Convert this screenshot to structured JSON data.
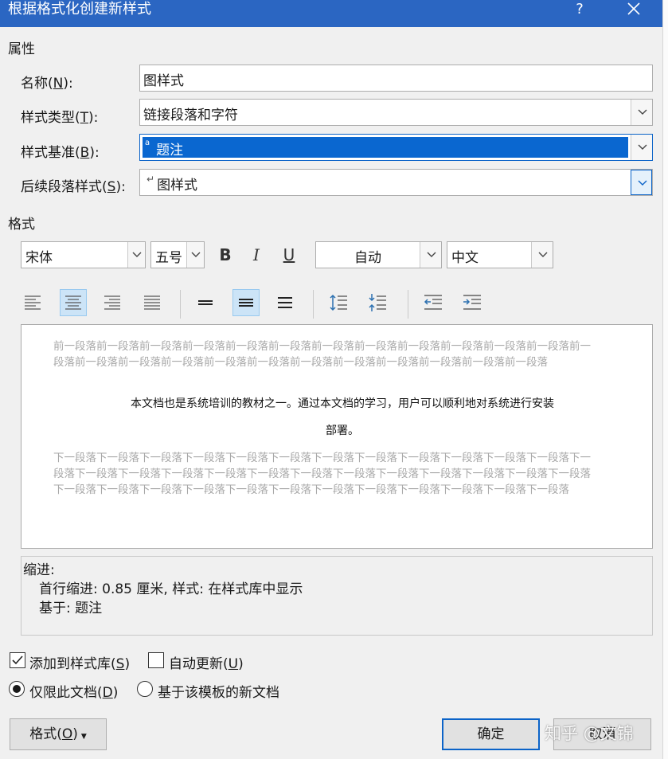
{
  "titlebar": {
    "title": "根据格式化创建新样式",
    "help": "?"
  },
  "properties": {
    "section": "属性",
    "name": {
      "label_pre": "名称(",
      "label_key": "N",
      "label_post": "):",
      "value": "图样式"
    },
    "style_type": {
      "label_pre": "样式类型(",
      "label_key": "T",
      "label_post": "):",
      "value": "链接段落和字符"
    },
    "based_on": {
      "label_pre": "样式基准(",
      "label_key": "B",
      "label_post": "):",
      "value": "题注",
      "glyph": "a"
    },
    "next_style": {
      "label_pre": "后续段落样式(",
      "label_key": "S",
      "label_post": "):",
      "value": "图样式",
      "glyph": "↵"
    }
  },
  "format": {
    "section": "格式",
    "font": "宋体",
    "size": "五号",
    "bold": "B",
    "italic": "I",
    "underline": "U",
    "color": "自动",
    "script": "中文"
  },
  "preview": {
    "prev_para": "前一段落前一段落前一段落前一段落前一段落前一段落前一段落前一段落前一段落前一段落前一段落前一段落前一段落前一段落前一段落前一段落前一段落前一段落前一段落前一段落前一段落前一段落前一段落前一段落",
    "sample_line1": "本文档也是系统培训的教材之一。通过本文档的学习，用户可以顺利地对系统进行安装",
    "sample_line2": "部署。",
    "next_para": "下一段落下一段落下一段落下一段落下一段落下一段落下一段落下一段落下一段落下一段落下一段落下一段落下一段落下一段落下一段落下一段落下一段落下一段落下一段落下一段落下一段落下一段落下一段落下一段落下一段落下一段落下一段落下一段落下一段落下一段落下一段落下一段落下一段落下一段落下一段落下一段落下一段落"
  },
  "description": {
    "heading": "缩进:",
    "line1": "首行缩进:  0.85 厘米, 样式: 在样式库中显示",
    "line2": "基于: 题注"
  },
  "options": {
    "add_to_gallery": {
      "pre": "添加到样式库(",
      "key": "S",
      "post": ")",
      "checked": true
    },
    "auto_update": {
      "pre": "自动更新(",
      "key": "U",
      "post": ")",
      "checked": false
    },
    "only_this_doc": {
      "pre": "仅限此文档(",
      "key": "D",
      "post": ")",
      "selected": true
    },
    "new_docs_template": {
      "label": "基于该模板的新文档",
      "selected": false
    }
  },
  "buttons": {
    "format": {
      "pre": "格式(",
      "key": "O",
      "post": ")"
    },
    "ok": "确定",
    "cancel": "取消"
  },
  "watermark": "知乎 @文锦",
  "colors": {
    "titlebar": "#2b66c2",
    "selection": "#0a67d0",
    "dialog_bg": "#f0f0f0",
    "active_toggle": "#cce4f7"
  }
}
